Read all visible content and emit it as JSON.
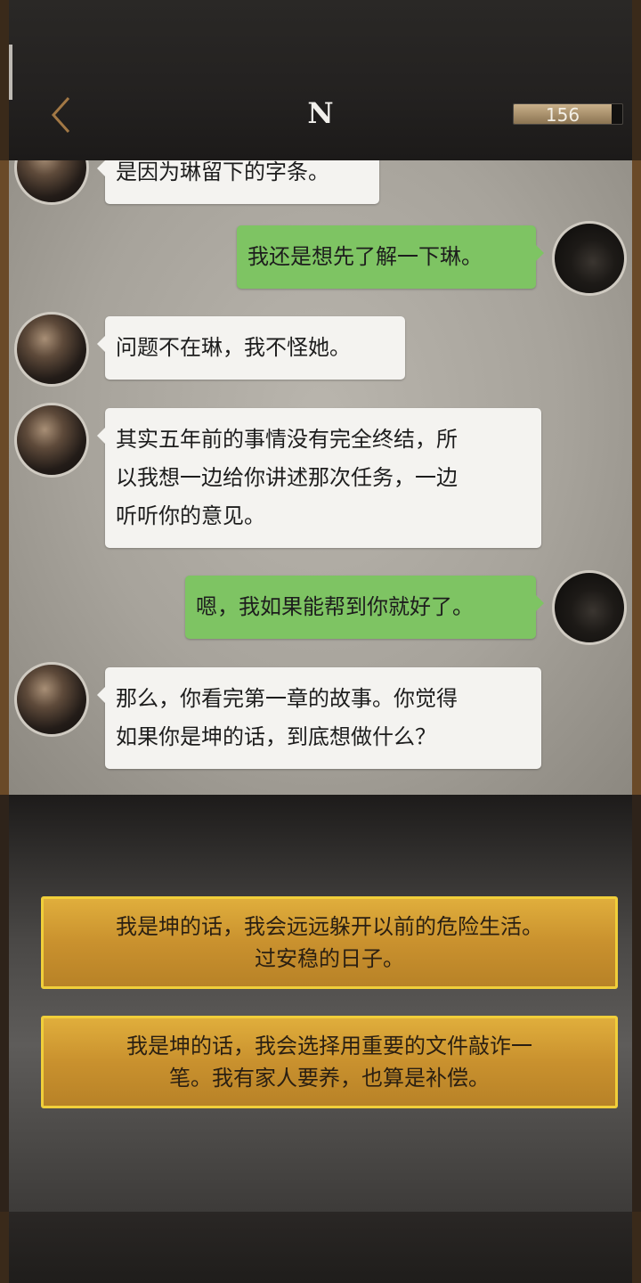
{
  "header": {
    "title": "N",
    "back_icon": "chevron-left-icon",
    "coins": "156",
    "coin_level": 0.9
  },
  "messages": [
    {
      "side": "left",
      "avatar": "man",
      "lines": [
        "是因为琳留下的字条。"
      ]
    },
    {
      "side": "right",
      "avatar": "dark",
      "lines": [
        "我还是想先了解一下琳。"
      ]
    },
    {
      "side": "left",
      "avatar": "man",
      "lines": [
        "问题不在琳，我不怪她。"
      ]
    },
    {
      "side": "left",
      "avatar": "man",
      "lines": [
        "其实五年前的事情没有完全终结，所",
        "以我想一边给你讲述那次任务，一边",
        "听听你的意见。"
      ]
    },
    {
      "side": "right",
      "avatar": "dark",
      "lines": [
        "嗯，我如果能帮到你就好了。"
      ]
    },
    {
      "side": "left",
      "avatar": "man",
      "lines": [
        "那么，你看完第一章的故事。你觉得",
        "如果你是坤的话，到底想做什么？"
      ]
    }
  ],
  "choices": [
    {
      "lines": [
        "我是坤的话，我会远远躲开以前的危险生活。",
        "过安稳的日子。"
      ]
    },
    {
      "lines": [
        "我是坤的话，我会选择用重要的文件敲诈一",
        "笔。我有家人要养，也算是补偿。"
      ]
    }
  ],
  "colors": {
    "bubble_left": "#f4f3f0",
    "bubble_right": "#7ec463",
    "choice_fill": "#c9912e",
    "choice_border": "#f1cf3a"
  }
}
